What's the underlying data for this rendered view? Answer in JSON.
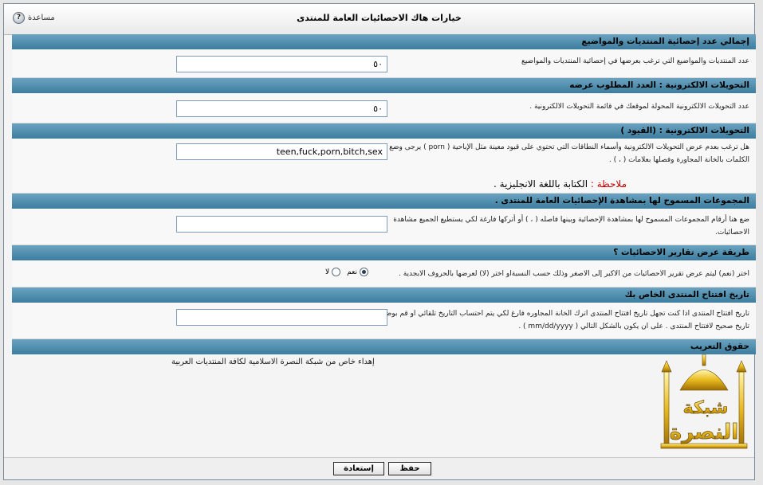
{
  "title": "خيارات هاك الاحصائيات العامة للمنتدى",
  "help_label": "مساعدة",
  "sections": [
    {
      "header": "إجمالي عدد إحصائية المنتديات والمواضيع",
      "description": "عدد المنتديات والمواضيع التي ترغب بعرضها في إحصائية المنتديات والمواضيع",
      "value": "٥٠"
    },
    {
      "header": "التحويلات الالكترونية : العدد المطلوب عرضه",
      "description": "عدد التحويلات الالكترونية المحولة لموقعك في قائمة التحويلات الالكترونية .",
      "value": "٥٠"
    },
    {
      "header": "التحويلات الالكترونية : (القيود )",
      "description_line1": "هل ترغب بعدم عرض التحويلات الالكترونية وأسماء النطاقات التي تحتوي على قيود معينة مثل الإباحية ( porn ) يرجى وضع",
      "description_line2": "الكلمات بالخانة المجاورة وفصلها بعلامات ( ، ) .",
      "value": "teen,fuck,porn,bitch,sex",
      "note_label": "ملاحظة :",
      "note_text": "الكتابة باللغة الانجليزية ."
    },
    {
      "header": "المجموعات المسموح لها بمشاهدة الإحصائيات العامة للمنتدى .",
      "description_line1": "ضع هنا أرقام المجموعات المسموح لها بمشاهدة الإحصائية وبينها فاصله ( ، ) أو أتركها فارغة لكي يستطيع الجميع مشاهدة",
      "description_line2": "الاحصائيات.",
      "value": ""
    },
    {
      "header": "طريقة عرض تقارير الاحصائيات ؟",
      "description": "اختر (نعم) ليتم عرض تقرير الاحصائيات من الاكبر إلى الاصغر وذلك حسب النسبةاو اختر (لا) لعرضها بالحروف الابجدية .",
      "options": [
        {
          "label": "نعم",
          "checked": true
        },
        {
          "label": "لا",
          "checked": false
        }
      ]
    },
    {
      "header": "تاريخ افتتاح المنتدى الخاص بك",
      "description_line1": "تاريخ افتتاح المنتدى اذا كنت تجهل تاريخ افتتاح المنتدى اترك الخانة المجاوره فارغ لكي يتم احتساب التاريخ تلقائي او قم بوضع",
      "description_line2": "تاريخ صحيح لافتتاح المنتدى . على ان يكون بالشكل التالي ( mm/dd/yyyy ) .",
      "value": ""
    },
    {
      "header": "حقوق التعريب",
      "credit": "إهداء خاص من شبكة النصرة الاسلامية لكافة المنتديات العربية",
      "logo_top": "شبكة",
      "logo_bottom": "النصرة"
    }
  ],
  "footer": {
    "save_label": "حفظ",
    "reset_label": "إستعادة"
  },
  "icons": {
    "help": "question-icon",
    "logo": "mosque-logo"
  }
}
